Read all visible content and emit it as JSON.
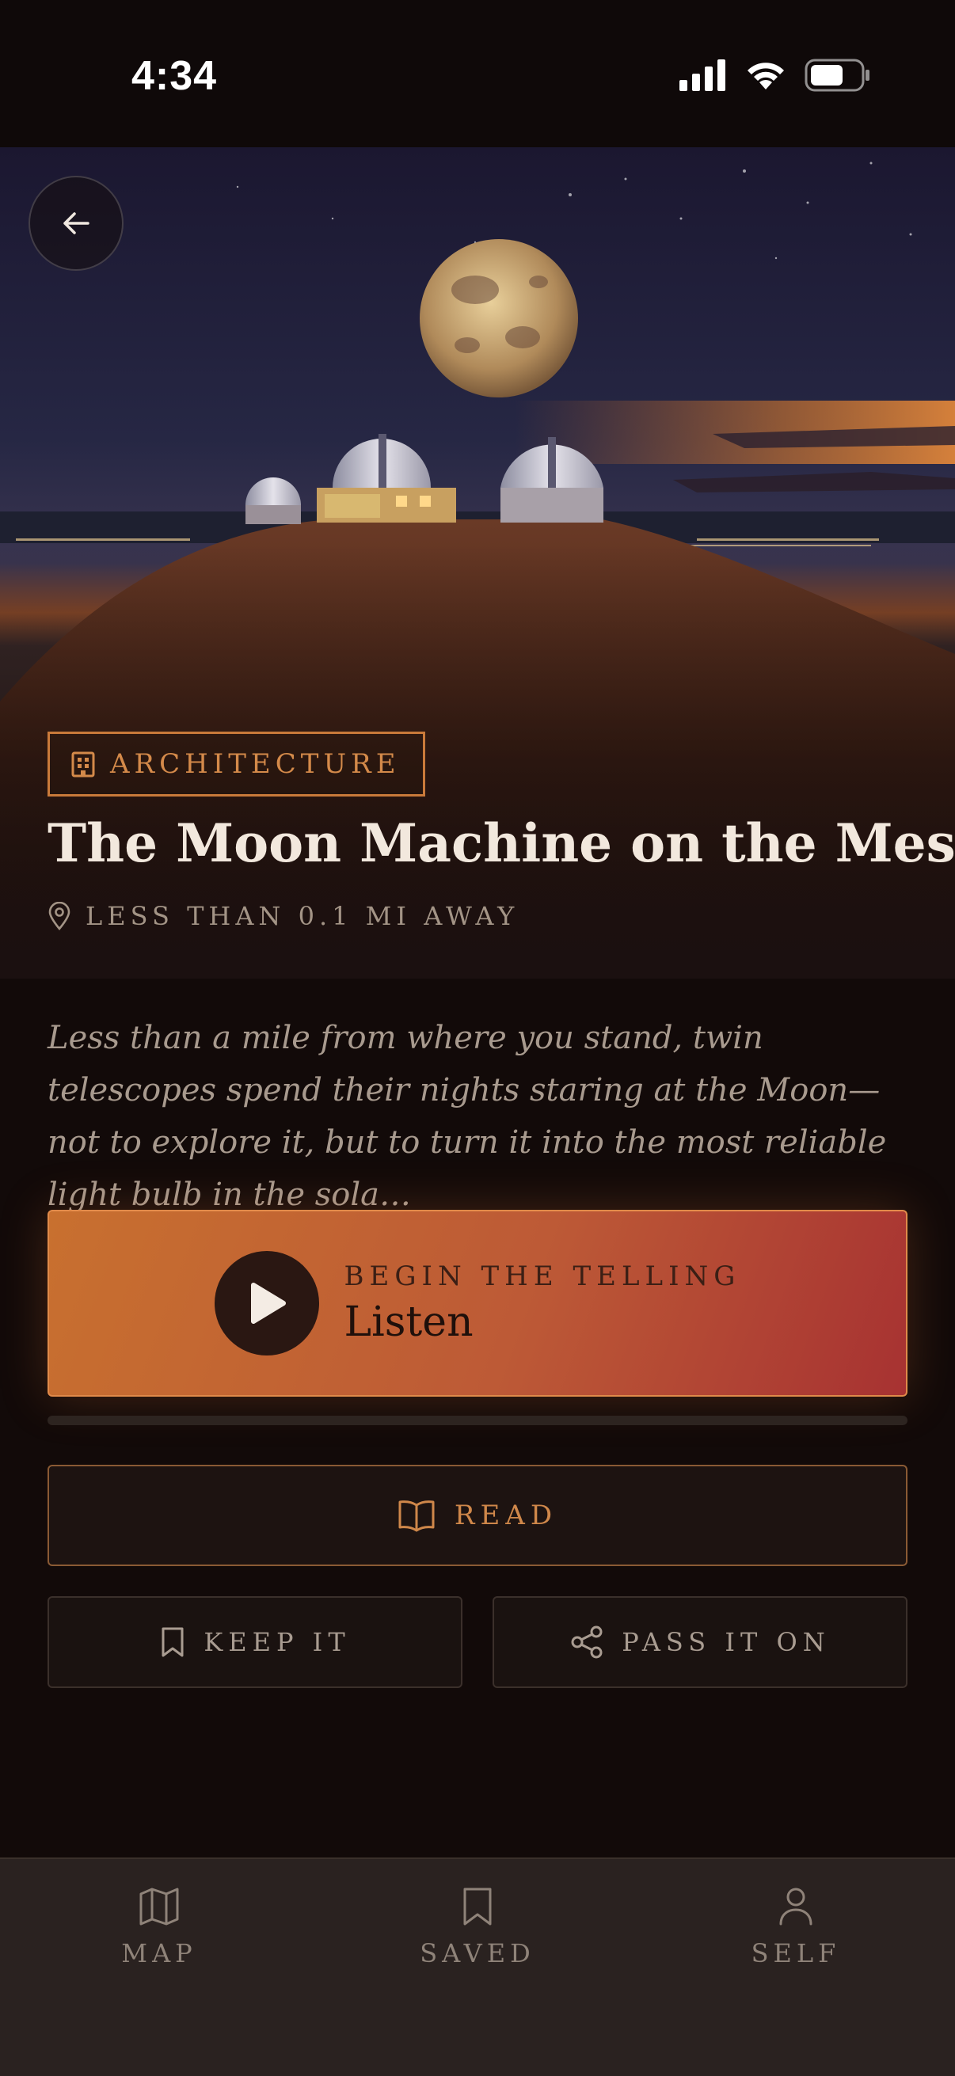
{
  "status_bar": {
    "time": "4:34",
    "icons": [
      "signal-icon",
      "wifi-icon",
      "battery-icon"
    ]
  },
  "hero": {
    "back_icon": "arrow-left-icon",
    "category": {
      "icon": "building-icon",
      "label": "ARCHITECTURE"
    },
    "title": "The Moon Machine on the Mesa",
    "distance": {
      "icon": "map-pin-icon",
      "label": "LESS THAN 0.1 MI AWAY"
    }
  },
  "excerpt": "Less than a mile from where you stand, twin telescopes spend their nights staring at the Moon—not to explore it, but to turn it into the most reliable light bulb in the sola…",
  "listen": {
    "kicker": "BEGIN THE TELLING",
    "label": "Listen",
    "icon": "play-icon",
    "progress": 0
  },
  "actions": {
    "read": {
      "label": "READ",
      "icon": "book-open-icon"
    },
    "keep": {
      "label": "KEEP IT",
      "icon": "bookmark-icon"
    },
    "share": {
      "label": "PASS IT ON",
      "icon": "share-icon"
    }
  },
  "tab_bar": {
    "items": [
      {
        "label": "MAP",
        "icon": "map-icon"
      },
      {
        "label": "SAVED",
        "icon": "bookmark-icon"
      },
      {
        "label": "SELF",
        "icon": "user-icon"
      }
    ]
  },
  "colors": {
    "accent": "#c97a3a",
    "background": "#120a09",
    "listen_gradient_start": "#c8702f",
    "listen_gradient_end": "#a73232"
  }
}
